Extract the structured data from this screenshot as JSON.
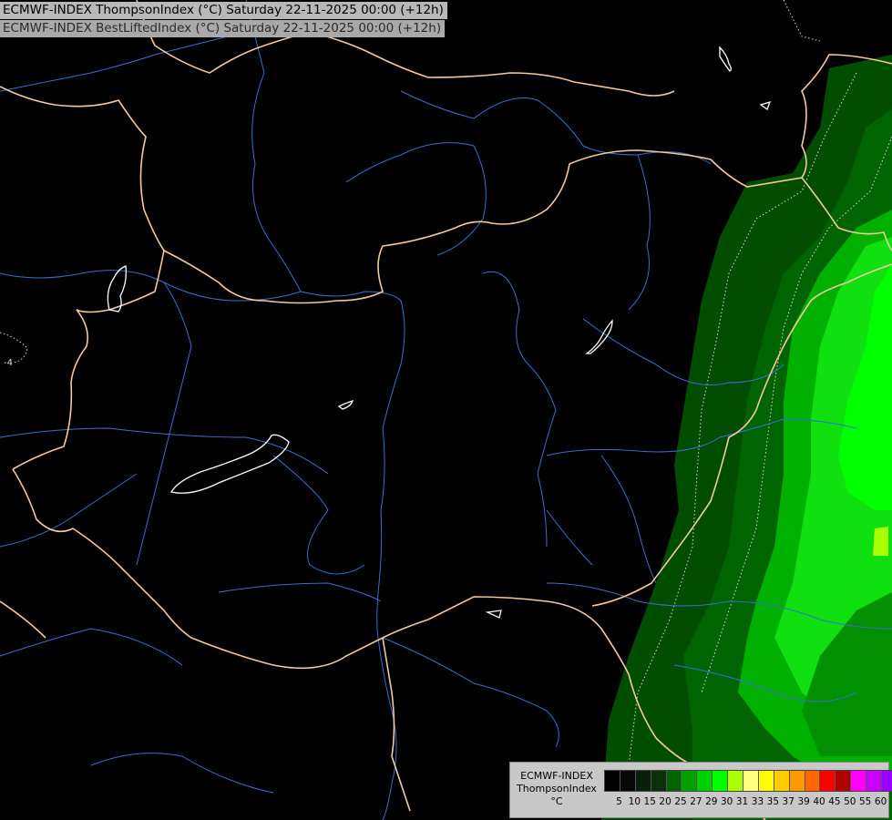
{
  "titles": {
    "line1": "ECMWF-INDEX ThompsonIndex (°C) Saturday 22-11-2025 00:00 (+12h)",
    "line2": "ECMWF-INDEX BestLiftedIndex (°C) Saturday 22-11-2025 00:00 (+12h)"
  },
  "map": {
    "background": "#000000",
    "border_color": "#f3c9a0",
    "river_color": "#3a6fd0",
    "lake_outline_color": "#ffffff",
    "contour_label": "-4"
  },
  "legend": {
    "model": "ECMWF-INDEX",
    "parameter": "ThompsonIndex",
    "unit": "°C",
    "colors": [
      "#000000",
      "#080808",
      "#0a200a",
      "#0c300c",
      "#006400",
      "#00a000",
      "#00d000",
      "#00ff00",
      "#aaff00",
      "#ffff80",
      "#ffff00",
      "#ffcc00",
      "#ff9900",
      "#ff6600",
      "#ff0000",
      "#b00000",
      "#ff00ff",
      "#cc00ff",
      "#9900ff",
      "#5a00ff",
      "#0000ff"
    ],
    "ticks": [
      "5",
      "10",
      "15",
      "20",
      "25",
      "27",
      "29",
      "30",
      "31",
      "33",
      "35",
      "37",
      "39",
      "40",
      "45",
      "50",
      "55",
      "60"
    ]
  }
}
